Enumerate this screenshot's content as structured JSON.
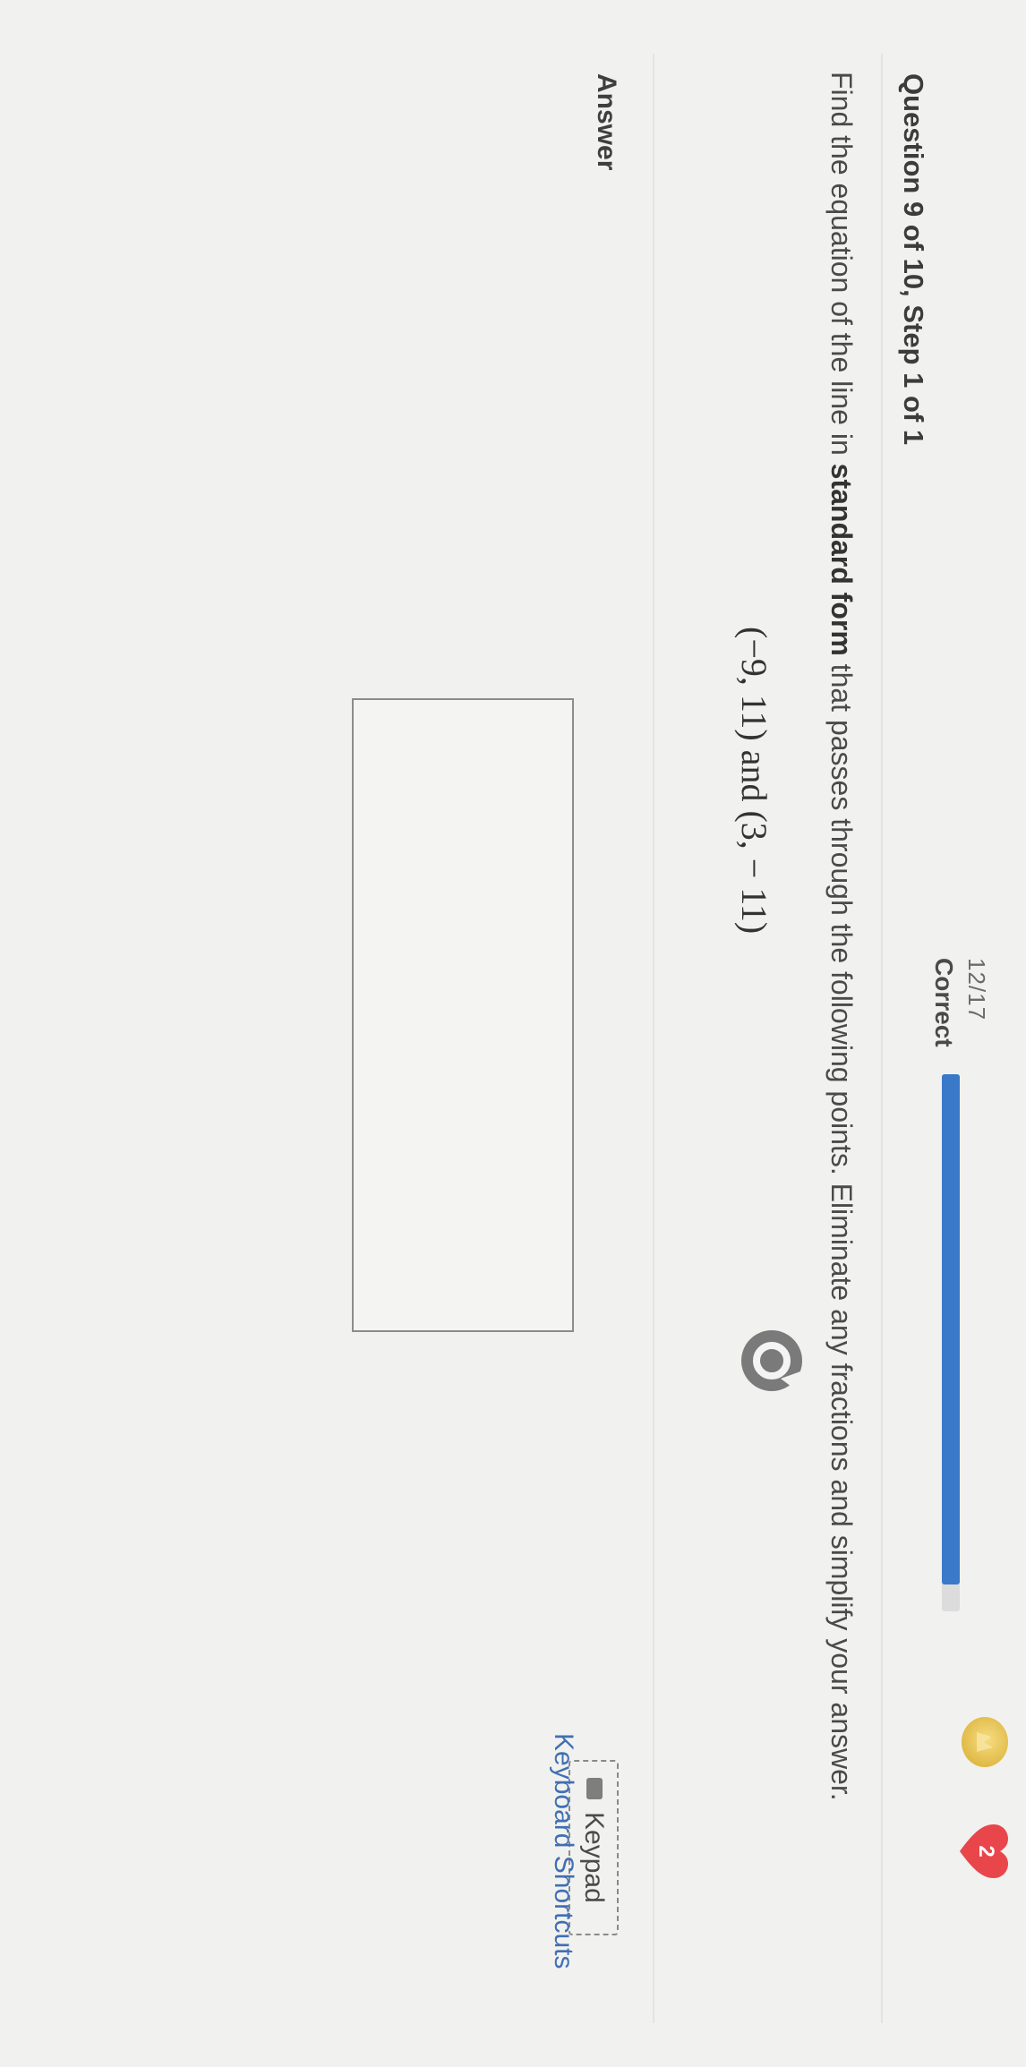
{
  "header": {
    "question_title": "Question 9 of 10, Step 1 of 1",
    "progress_count": "12/17",
    "progress_label": "Correct",
    "progress_fraction": 0.95,
    "heart_count": "2",
    "accent_color": "#3a79c9",
    "heart_color": "#e8464b"
  },
  "question": {
    "prompt_before": "Find the equation of the line in ",
    "prompt_bold": "standard form",
    "prompt_after": " that passes through the following points. Eliminate any fractions and simplify your answer.",
    "points": "(−9, 11) and (3, − 11)"
  },
  "answer": {
    "label": "Answer",
    "value": ""
  },
  "tools": {
    "keypad_label": "Keypad",
    "shortcuts_label": "Keyboard Shortcuts"
  }
}
